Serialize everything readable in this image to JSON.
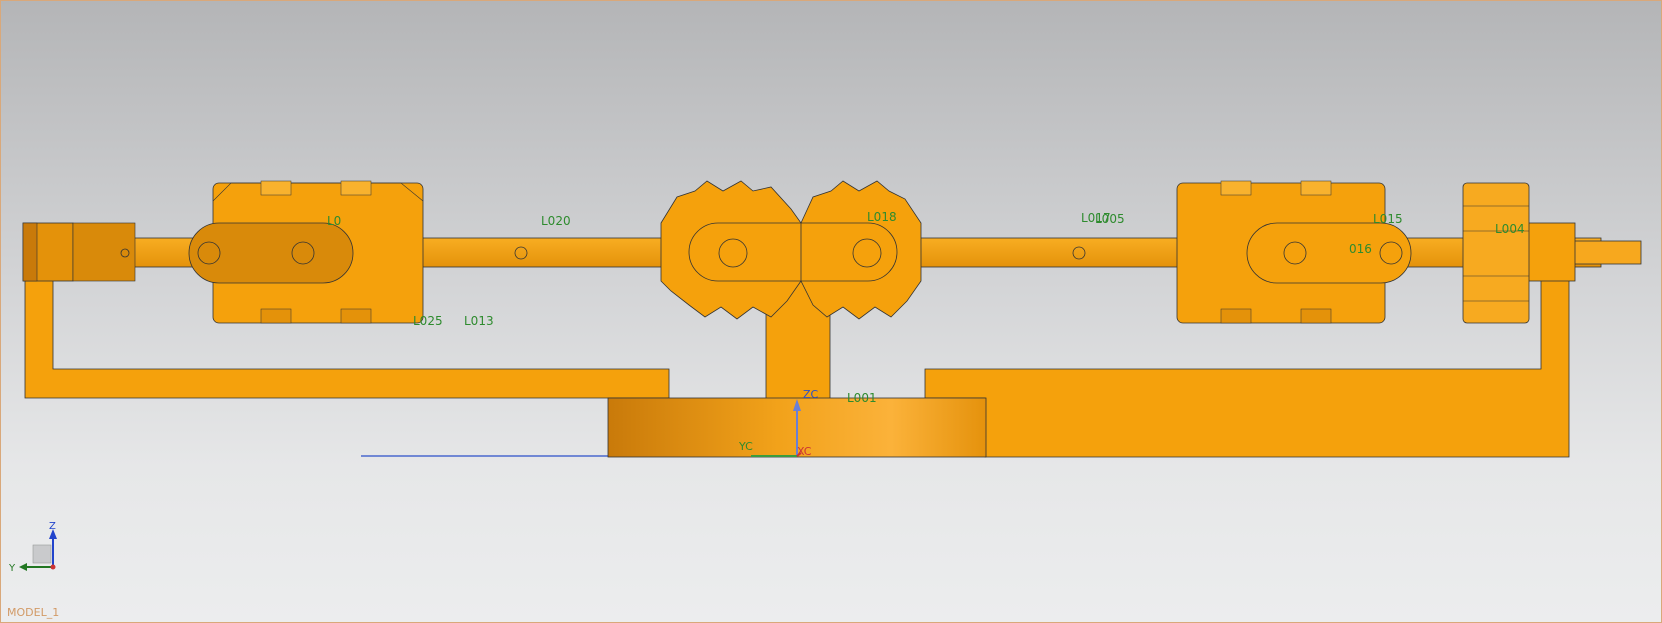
{
  "window": {
    "model_name": "MODEL_1"
  },
  "wcs": {
    "zc": "ZC",
    "yc": "YC",
    "xc": "XC"
  },
  "triad": {
    "z": "Z",
    "y": "Y"
  },
  "part_labels": {
    "l020": "L020",
    "l018": "L018",
    "l017": "L017",
    "l005": "L005",
    "l025": "L025",
    "l013": "L013",
    "l001": "L001",
    "l004": "L004",
    "l016": "016",
    "l015": "L015",
    "l0": "L0"
  },
  "colors": {
    "part_orange": "#f5a10c",
    "part_dark": "#c97a0a",
    "label_green": "#2e8b2e",
    "axis_blue": "#2b4fc9"
  }
}
